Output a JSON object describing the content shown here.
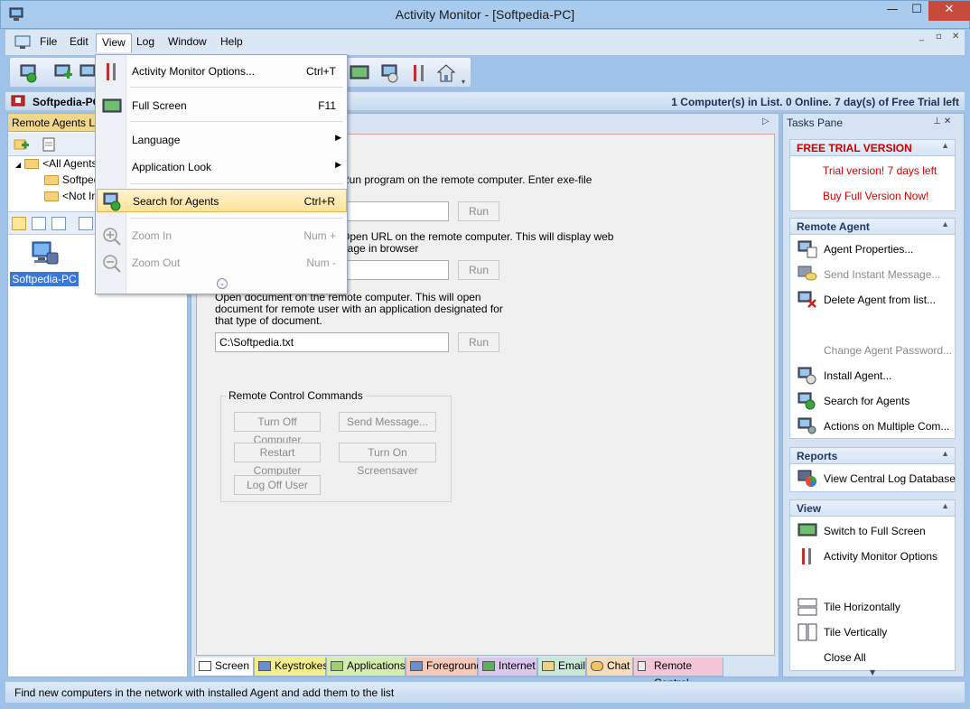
{
  "window": {
    "title": "Activity Monitor - [Softpedia-PC]",
    "controls": {
      "minimize": "—",
      "maximize": "☐",
      "close": "✕"
    }
  },
  "menubar": {
    "items": [
      "File",
      "Edit",
      "View",
      "Log",
      "Window",
      "Help"
    ],
    "active": "View",
    "mdi_controls": [
      "_",
      "▫",
      "✕"
    ]
  },
  "infostrip": {
    "computer": "Softpedia-PC",
    "message": "1 Computer(s) in List. 0 Online. 7 day(s) of Free Trial left"
  },
  "left_panel": {
    "header": "Remote Agents List",
    "tree": [
      {
        "label": "<All Agents>"
      },
      {
        "label": "Softpedia-PC"
      },
      {
        "label": "<Not In Group>"
      }
    ],
    "selected_agent": "Softpedia-PC"
  },
  "center_panel": {
    "collapse_arrow": "▷",
    "run_exe_desc": "Run program on the remote computer. Enter exe-file",
    "open_url_desc_1": "Open URL on the remote computer. This will display web",
    "open_url_desc_2": "page in browser",
    "open_doc_desc": "Open document on the remote computer. This will open document for remote user with an application designated for that type of document.",
    "doc_value": "C:\\Softpedia.txt",
    "run_label": "Run",
    "remote_control_group": "Remote Control Commands",
    "commands": {
      "turn_off": "Turn Off Computer",
      "send_message": "Send Message...",
      "restart": "Restart Computer",
      "screensaver": "Turn On Screensaver",
      "log_off": "Log Off User"
    },
    "tabs": [
      "Screen",
      "Keystrokes",
      "Applications",
      "Foreground",
      "Internet",
      "Email",
      "Chat",
      "Remote Control"
    ]
  },
  "tasks_pane": {
    "title": "Tasks Pane",
    "pin": "⊥ ✕",
    "trial": {
      "header": "FREE TRIAL VERSION",
      "line1": "Trial version! 7 days left",
      "line2": "Buy Full Version Now!"
    },
    "remote_agent": {
      "header": "Remote Agent",
      "items": [
        "Agent Properties...",
        "Send Instant Message...",
        "Delete Agent from list...",
        "Change Agent Password...",
        "Install Agent...",
        "Search for Agents",
        "Actions on Multiple Com..."
      ]
    },
    "reports": {
      "header": "Reports",
      "items": [
        "View Central Log Database"
      ]
    },
    "view": {
      "header": "View",
      "items": [
        "Switch to Full Screen",
        "Activity Monitor Options",
        "Tile Horizontally",
        "Tile Vertically",
        "Close All"
      ]
    },
    "scroll_down": "▼"
  },
  "statusbar": {
    "text": "Find new computers in the network with installed Agent and add them to the list"
  },
  "view_menu": {
    "items": [
      {
        "label": "Activity Monitor Options...",
        "shortcut": "Ctrl+T"
      },
      {
        "label": "Full Screen",
        "shortcut": "F11"
      },
      {
        "label": "Language",
        "shortcut": ""
      },
      {
        "label": "Application Look",
        "shortcut": ""
      },
      {
        "label": "Search for Agents",
        "shortcut": "Ctrl+R"
      },
      {
        "label": "Zoom In",
        "shortcut": "Num +"
      },
      {
        "label": "Zoom Out",
        "shortcut": "Num -"
      }
    ],
    "submenu_arrow": "▶",
    "more": "⌄"
  },
  "colors": {
    "accent": "#3b78d6",
    "highlight": "#ffe39a",
    "trial_red": "#cc0000"
  }
}
